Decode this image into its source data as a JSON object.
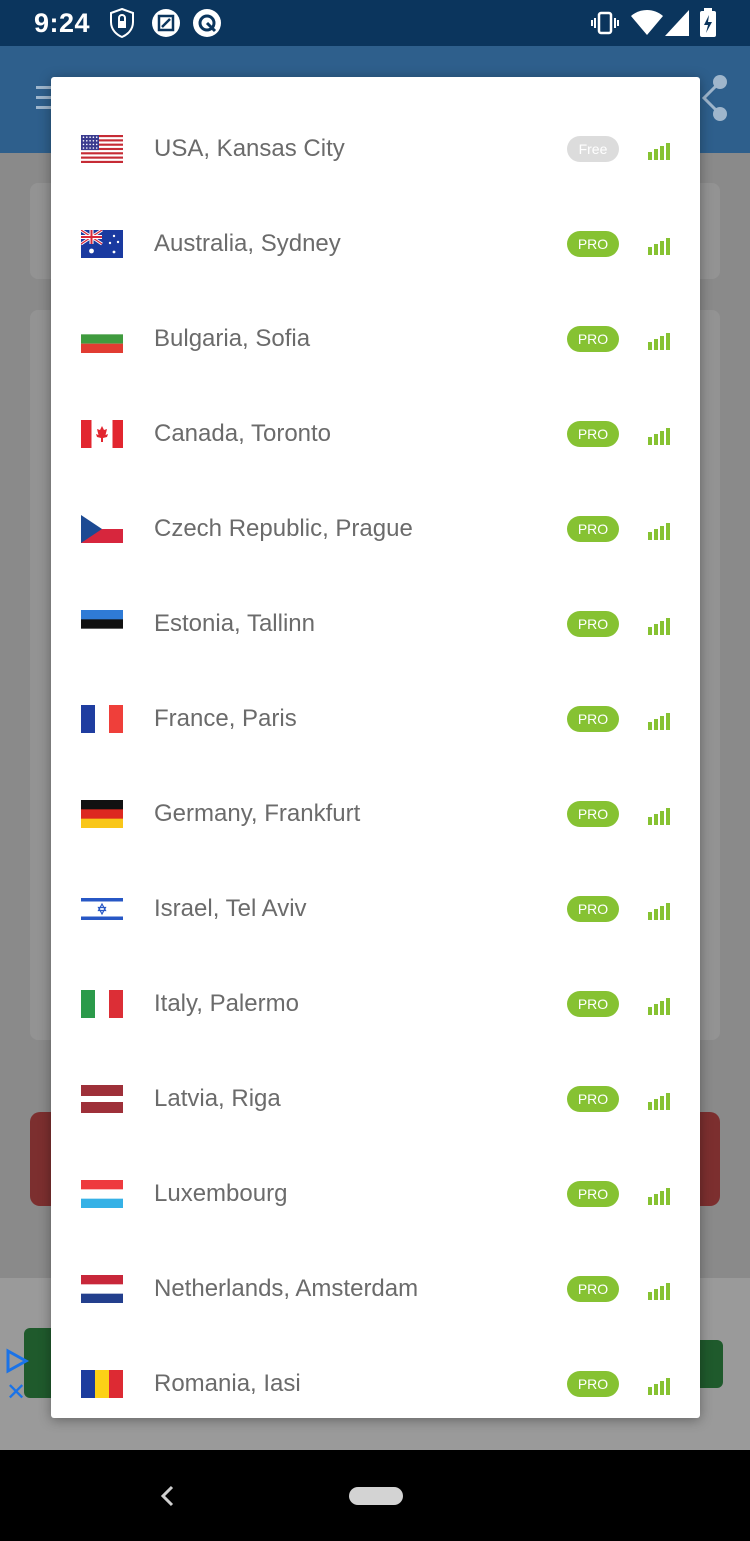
{
  "status_bar": {
    "time": "9:24",
    "left_icons": [
      "vpn-shield-icon",
      "screenshot-app-icon",
      "sync-app-icon"
    ],
    "right_icons": [
      "vibrate-icon",
      "wifi-icon",
      "cell-signal-icon",
      "battery-icon"
    ]
  },
  "dialog": {
    "servers": [
      {
        "label": "USA,  Kansas City",
        "badge": "Free",
        "tier": "free",
        "flag": "us"
      },
      {
        "label": "Australia, Sydney",
        "badge": "PRO",
        "tier": "pro",
        "flag": "au"
      },
      {
        "label": "Bulgaria, Sofia",
        "badge": "PRO",
        "tier": "pro",
        "flag": "bg"
      },
      {
        "label": "Canada, Toronto",
        "badge": "PRO",
        "tier": "pro",
        "flag": "ca"
      },
      {
        "label": "Czech Republic, Prague",
        "badge": "PRO",
        "tier": "pro",
        "flag": "cz"
      },
      {
        "label": "Estonia, Tallinn",
        "badge": "PRO",
        "tier": "pro",
        "flag": "ee"
      },
      {
        "label": "France, Paris",
        "badge": "PRO",
        "tier": "pro",
        "flag": "fr"
      },
      {
        "label": "Germany, Frankfurt",
        "badge": "PRO",
        "tier": "pro",
        "flag": "de"
      },
      {
        "label": "Israel, Tel Aviv",
        "badge": "PRO",
        "tier": "pro",
        "flag": "il"
      },
      {
        "label": "Italy, Palermo",
        "badge": "PRO",
        "tier": "pro",
        "flag": "it"
      },
      {
        "label": "Latvia, Riga",
        "badge": "PRO",
        "tier": "pro",
        "flag": "lv"
      },
      {
        "label": "Luxembourg",
        "badge": "PRO",
        "tier": "pro",
        "flag": "lu"
      },
      {
        "label": "Netherlands, Amsterdam",
        "badge": "PRO",
        "tier": "pro",
        "flag": "nl"
      },
      {
        "label": "Romania, Iasi",
        "badge": "PRO",
        "tier": "pro",
        "flag": "ro"
      }
    ]
  },
  "colors": {
    "pro_badge": "#86c232",
    "free_badge": "#dcdcdc",
    "signal": "#86c232",
    "status_bar": "#0b355d",
    "app_header": "#2e5f8c"
  },
  "nav_bar": {
    "icons": [
      "back-icon",
      "home-pill-icon"
    ]
  }
}
